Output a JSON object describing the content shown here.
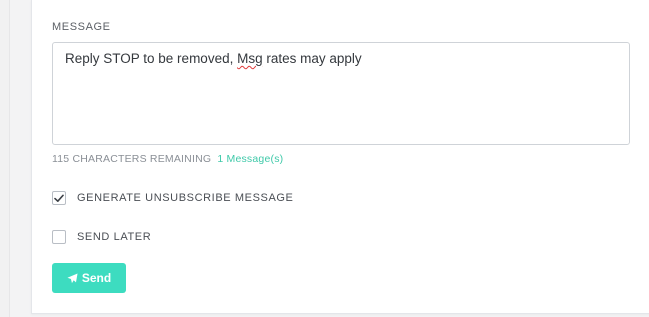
{
  "form": {
    "message_label": "MESSAGE",
    "message_text_before": "Reply STOP to be removed, ",
    "message_text_misspelled": "Msg",
    "message_text_after": " rates may apply",
    "chars_remaining": "115 CHARACTERS REMAINING",
    "message_count": "1 Message(s)",
    "unsubscribe_label": "GENERATE UNSUBSCRIBE MESSAGE",
    "unsubscribe_checked": true,
    "send_later_label": "SEND LATER",
    "send_later_checked": false,
    "send_button_label": "Send"
  },
  "colors": {
    "accent": "#3ddcc0",
    "link": "#3fc9a9"
  }
}
